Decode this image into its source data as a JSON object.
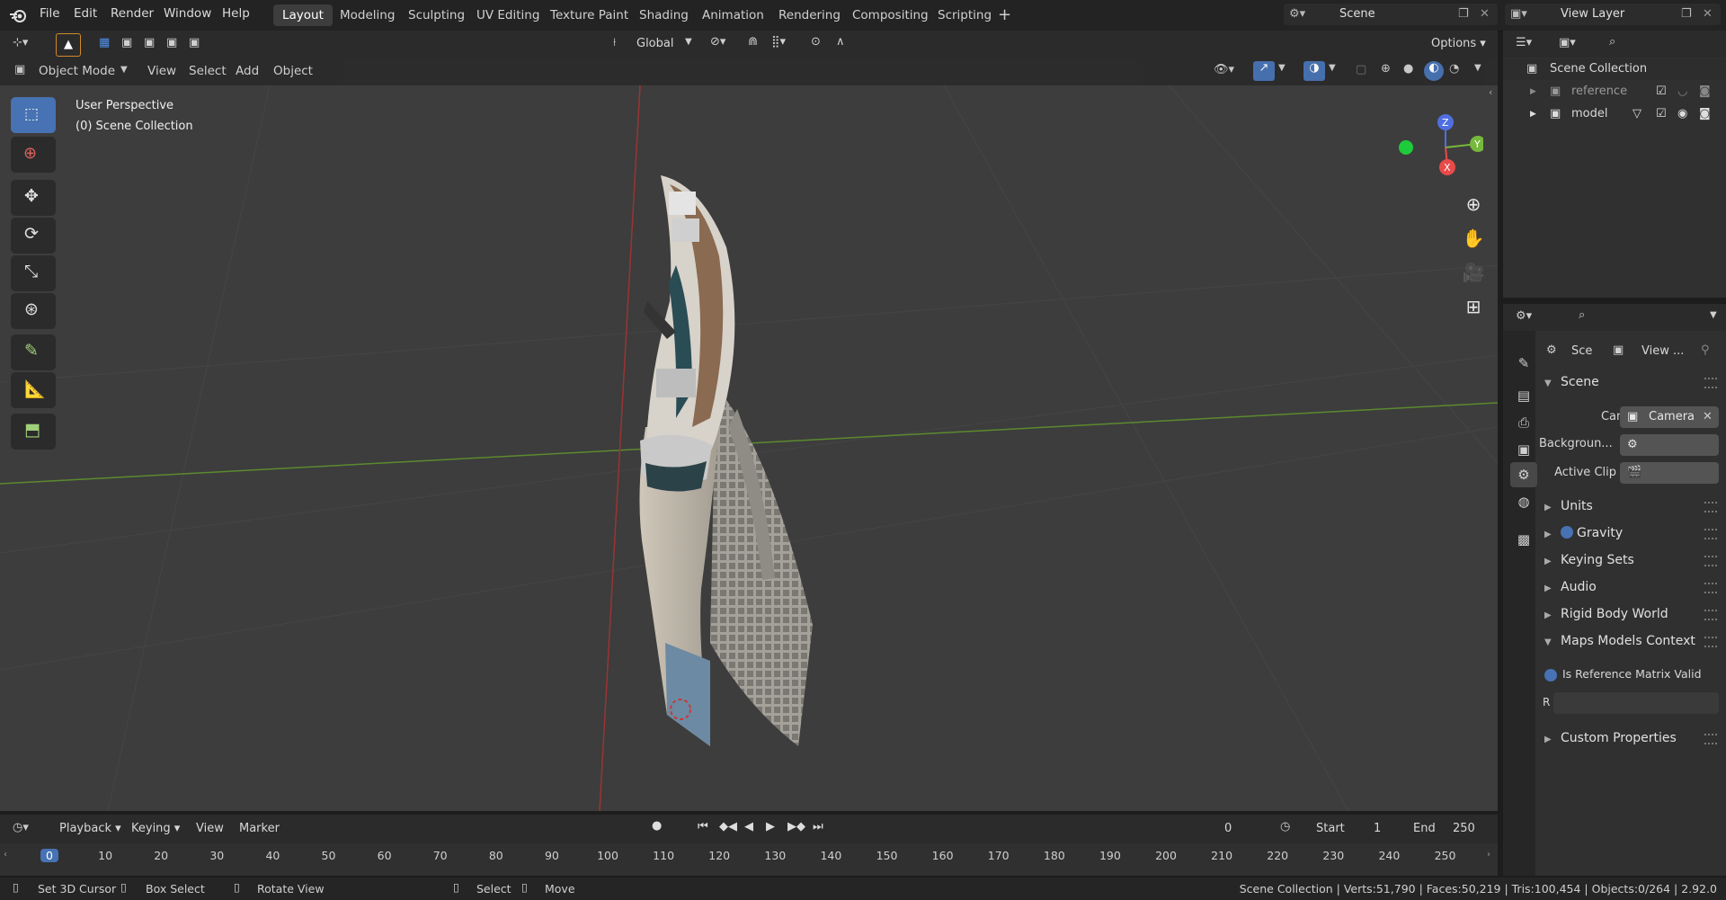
{
  "menu": {
    "items": [
      "File",
      "Edit",
      "Render",
      "Window",
      "Help"
    ],
    "workspaces": [
      "Layout",
      "Modeling",
      "Sculpting",
      "UV Editing",
      "Texture Paint",
      "Shading",
      "Animation",
      "Rendering",
      "Compositing",
      "Scripting"
    ],
    "active_workspace": "Layout",
    "scene": "Scene",
    "view_layer": "View Layer"
  },
  "viewport": {
    "transform_orientation": "Global",
    "options_label": "Options",
    "mode": "Object Mode",
    "menus": [
      "View",
      "Select",
      "Add",
      "Object"
    ],
    "overlay_title": "User Perspective",
    "overlay_collection": "(0) Scene Collection",
    "gizmo_axes": [
      "Z",
      "Y",
      "X"
    ]
  },
  "outliner": {
    "root": "Scene Collection",
    "items": [
      {
        "name": "reference"
      },
      {
        "name": "model"
      }
    ]
  },
  "properties": {
    "tab_scene": "Sce",
    "tab_view": "View ...",
    "panels": {
      "scene": "Scene",
      "camera_label": "Camera",
      "camera_value": "Camera",
      "background_label": "Backgroun...",
      "active_clip_label": "Active Clip",
      "units": "Units",
      "gravity": "Gravity",
      "keying_sets": "Keying Sets",
      "audio": "Audio",
      "rigid_body": "Rigid Body World",
      "maps_context": "Maps Models Context",
      "is_ref_valid": "Is Reference Matrix Valid",
      "r_label": "R",
      "custom_props": "Custom Properties"
    }
  },
  "timeline": {
    "menus": [
      "Playback",
      "Keying",
      "View",
      "Marker"
    ],
    "current_frame": "0",
    "start_label": "Start",
    "start_value": "1",
    "end_label": "End",
    "end_value": "250",
    "ruler": [
      "0",
      "10",
      "20",
      "30",
      "40",
      "50",
      "60",
      "70",
      "80",
      "90",
      "100",
      "110",
      "120",
      "130",
      "140",
      "150",
      "160",
      "170",
      "180",
      "190",
      "200",
      "210",
      "220",
      "230",
      "240",
      "250"
    ]
  },
  "status": {
    "hints": [
      "Set 3D Cursor",
      "Box Select",
      "Rotate View",
      "Select",
      "Move"
    ],
    "stats": "Scene Collection | Verts:51,790 | Faces:50,219 | Tris:100,454 | Objects:0/264 | 2.92.0"
  },
  "colors": {
    "accent": "#4772b3",
    "x_axis": "#e84a4a",
    "y_axis": "#76b83c",
    "z_axis": "#4f6fe0"
  }
}
